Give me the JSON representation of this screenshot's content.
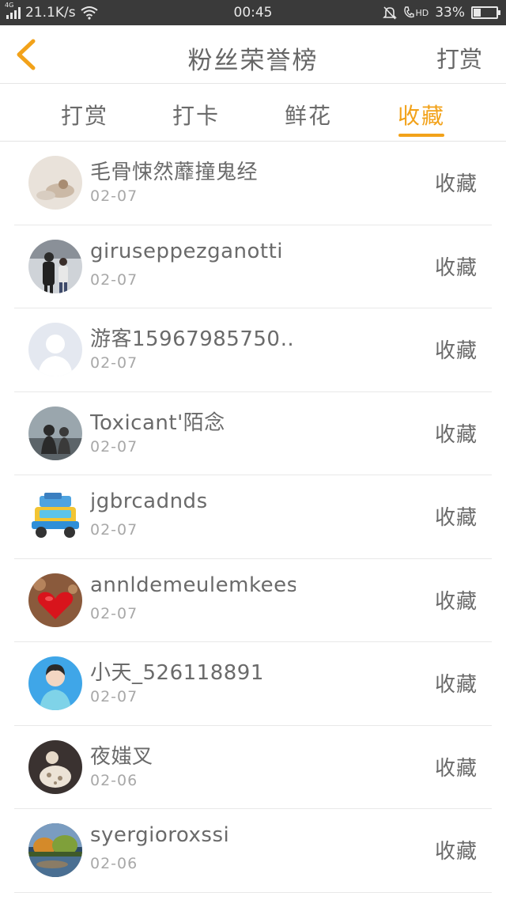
{
  "status_bar": {
    "network_label": "4G",
    "speed": "21.1K/s",
    "time": "00:45",
    "volte": "HD",
    "battery": "33%",
    "battery_level": 0.33
  },
  "header": {
    "back_icon": "chevron-left-icon",
    "title": "粉丝荣誉榜",
    "action_label": "打赏"
  },
  "tabs": [
    {
      "label": "打赏",
      "active": false
    },
    {
      "label": "打卡",
      "active": false
    },
    {
      "label": "鲜花",
      "active": false
    },
    {
      "label": "收藏",
      "active": true
    }
  ],
  "colors": {
    "accent": "#f2a21a",
    "status_bar_bg": "#3a3a3a",
    "text": "#6a6a6a",
    "subtext": "#a8a8a8"
  },
  "fans": [
    {
      "name": "毛骨悚然蘼撞鬼经",
      "date": "02-07",
      "action": "收藏",
      "avatar": "photo-avatar"
    },
    {
      "name": "giruseppezganotti",
      "date": "02-07",
      "action": "收藏",
      "avatar": "couple-photo-avatar"
    },
    {
      "name": "游客15967985750…",
      "date": "02-07",
      "action": "收藏",
      "avatar": "default-user-avatar"
    },
    {
      "name": "Toxicant'陌念",
      "date": "02-07",
      "action": "收藏",
      "avatar": "photo-avatar"
    },
    {
      "name": "jgbrcadnds",
      "date": "02-07",
      "action": "收藏",
      "avatar": "toy-car-avatar"
    },
    {
      "name": "annldemeulemkeest…",
      "date": "02-07",
      "action": "收藏",
      "avatar": "red-heart-avatar"
    },
    {
      "name": "小天_526118891",
      "date": "02-07",
      "action": "收藏",
      "avatar": "photo-avatar"
    },
    {
      "name": "夜媸叉",
      "date": "02-06",
      "action": "收藏",
      "avatar": "photo-avatar"
    },
    {
      "name": "syergioroxssi",
      "date": "02-06",
      "action": "收藏",
      "avatar": "landscape-photo-avatar"
    }
  ]
}
